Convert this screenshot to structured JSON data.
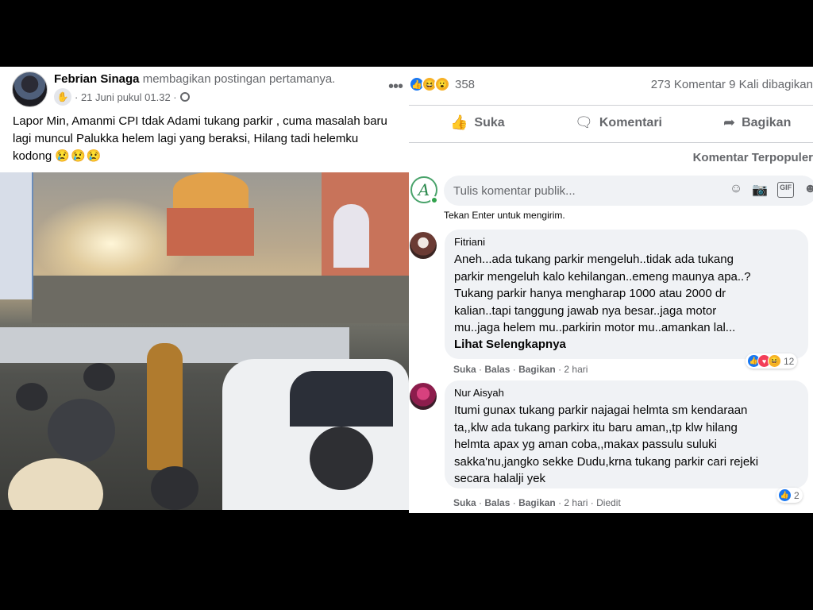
{
  "post": {
    "author": "Febrian Sinaga",
    "shared_text": "membagikan postingan pertamanya.",
    "date": "· 21 Juni pukul 01.32 ·",
    "text_lines": [
      "Lapor Min, Amanmi CPI tdak Adami tukang parkir , cuma masalah baru",
      "lagi muncul Palukka helem lagi yang beraksi, Hilang tadi helemku",
      "kodong"
    ],
    "emoji": "😢😢😢"
  },
  "stats": {
    "reaction_count": "358",
    "comments_shares": "273 Komentar  9 Kali dibagikan"
  },
  "actions": {
    "like": "Suka",
    "comment": "Komentari",
    "share": "Bagikan"
  },
  "sort_label": "Komentar Terpopuler",
  "comment_box": {
    "placeholder": "Tulis komentar publik...",
    "hint": "Tekan Enter untuk mengirim.",
    "gif": "GIF"
  },
  "comments": [
    {
      "name": "Fitriani",
      "lines": [
        "Aneh...ada tukang parkir mengeluh..tidak ada tukang",
        "parkir mengeluh kalo kehilangan..emeng maunya apa..?",
        "Tukang parkir hanya mengharap 1000 atau 2000 dr",
        "kalian..tapi tanggung jawab nya besar..jaga motor",
        "mu..jaga helem mu..parkirin motor mu..amankan lal..."
      ],
      "see_more": "Lihat Selengkapnya",
      "meta": {
        "like": "Suka",
        "reply": "Balas",
        "share": "Bagikan",
        "time": "· 2 hari"
      },
      "reaction_count": "12"
    },
    {
      "name": "Nur Aisyah",
      "lines": [
        "Itumi gunax tukang parkir najagai helmta sm kendaraan",
        "ta,,klw ada tukang parkirx itu baru aman,,tp klw hilang",
        "helmta apax yg aman coba,,makax passulu suluki",
        "sakka'nu,jangko sekke Dudu,krna tukang parkir cari rejeki",
        "secara halalji yek"
      ],
      "meta": {
        "like": "Suka",
        "reply": "Balas",
        "share": "Bagikan",
        "time": "· 2 hari",
        "edited": "· Diedit"
      },
      "reaction_count": "2"
    }
  ]
}
